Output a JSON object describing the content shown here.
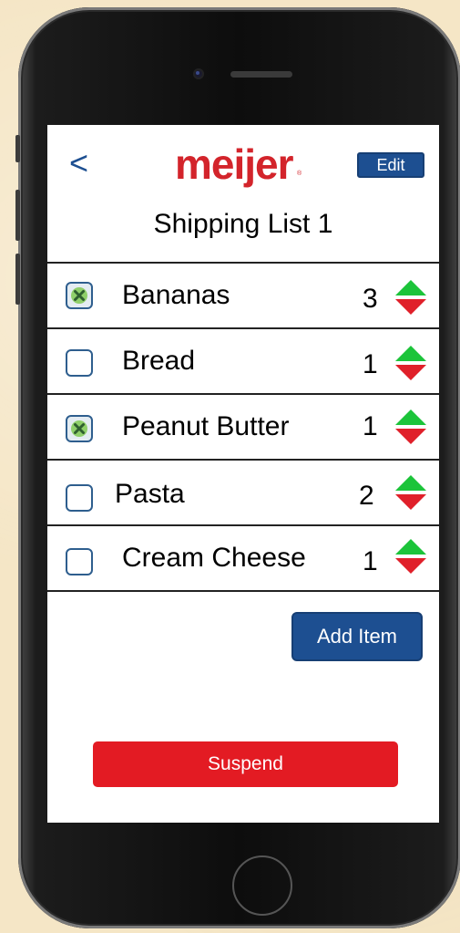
{
  "header": {
    "back_label": "<",
    "logo_text": "meijer",
    "logo_mark": "®",
    "edit_label": "Edit"
  },
  "list_title": "Shipping List 1",
  "items": [
    {
      "name": "Bananas",
      "quantity": "3",
      "checked": true
    },
    {
      "name": "Bread",
      "quantity": "1",
      "checked": false
    },
    {
      "name": "Peanut Butter",
      "quantity": "1",
      "checked": true
    },
    {
      "name": "Pasta",
      "quantity": "2",
      "checked": false
    },
    {
      "name": "Cream Cheese",
      "quantity": "1",
      "checked": false
    }
  ],
  "actions": {
    "add_item_label": "Add Item",
    "suspend_label": "Suspend"
  },
  "colors": {
    "brand_red": "#d3242b",
    "brand_blue": "#1d4f91",
    "increment_green": "#1cc43a",
    "decrement_red": "#e0202a",
    "suspend_red": "#e31b23"
  }
}
